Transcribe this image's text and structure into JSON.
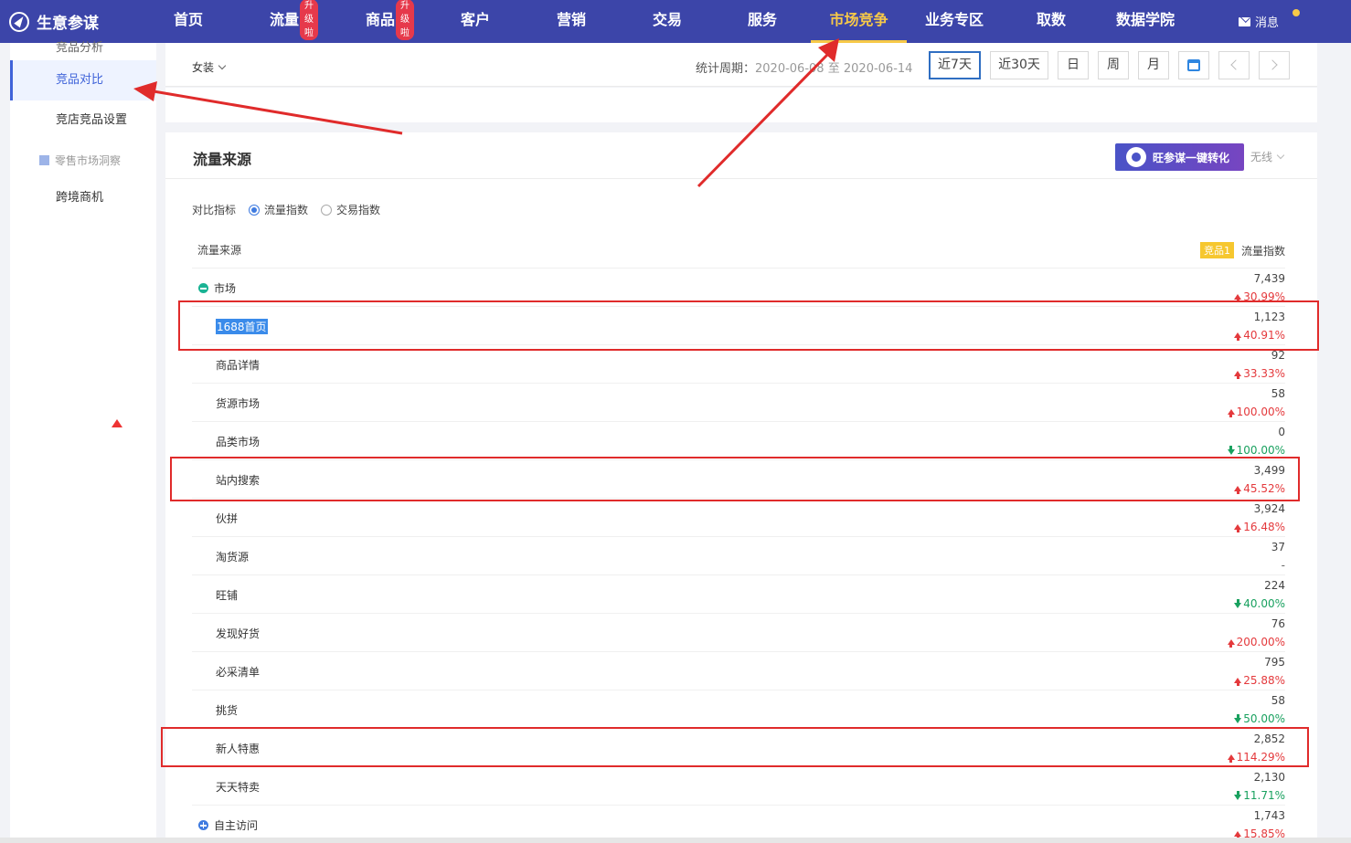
{
  "brand": {
    "name": "生意参谋"
  },
  "nav": {
    "items": [
      {
        "label": "首页"
      },
      {
        "label": "流量",
        "badge": "升级啦"
      },
      {
        "label": "商品",
        "badge": "升级啦"
      },
      {
        "label": "客户"
      },
      {
        "label": "营销"
      },
      {
        "label": "交易"
      },
      {
        "label": "服务"
      },
      {
        "label": "市场竞争",
        "active": true
      },
      {
        "label": "业务专区"
      },
      {
        "label": "取数"
      },
      {
        "label": "数据学院"
      }
    ],
    "message_label": "消息"
  },
  "sidebar": {
    "cut_item": "竞品分析",
    "items": [
      {
        "label": "竞品对比",
        "active": true
      },
      {
        "label": "竞店竞品设置"
      }
    ],
    "group_label": "零售市场洞察",
    "group_items": [
      {
        "label": "跨境商机"
      }
    ]
  },
  "filter": {
    "category": "女装",
    "period_label": "统计周期：",
    "period_start": "2020-06-08",
    "period_sep": "至",
    "period_end": "2020-06-14",
    "buttons": [
      "近7天",
      "近30天",
      "日",
      "周",
      "月"
    ]
  },
  "panel": {
    "title": "流量来源",
    "convert_button": "旺参谋一键转化",
    "device": "无线",
    "compare_label": "对比指标",
    "options": [
      "流量指数",
      "交易指数"
    ],
    "selected_option": "流量指数",
    "col_source": "流量来源",
    "item_tag": "竞品1",
    "col_metric": "流量指数"
  },
  "rows": [
    {
      "label": "市场",
      "value": "7,439",
      "change": "30.99%",
      "dir": "up",
      "group": "collapse",
      "highlight": false
    },
    {
      "label": "1688首页",
      "value": "1,123",
      "change": "40.91%",
      "dir": "up",
      "selected_text": true
    },
    {
      "label": "商品详情",
      "value": "92",
      "change": "33.33%",
      "dir": "up"
    },
    {
      "label": "货源市场",
      "value": "58",
      "change": "100.00%",
      "dir": "up"
    },
    {
      "label": "品类市场",
      "value": "0",
      "change": "100.00%",
      "dir": "down"
    },
    {
      "label": "站内搜索",
      "value": "3,499",
      "change": "45.52%",
      "dir": "up"
    },
    {
      "label": "伙拼",
      "value": "3,924",
      "change": "16.48%",
      "dir": "up"
    },
    {
      "label": "淘货源",
      "value": "37",
      "change": "-",
      "dir": "none"
    },
    {
      "label": "旺铺",
      "value": "224",
      "change": "40.00%",
      "dir": "down"
    },
    {
      "label": "发现好货",
      "value": "76",
      "change": "200.00%",
      "dir": "up"
    },
    {
      "label": "必采清单",
      "value": "795",
      "change": "25.88%",
      "dir": "up"
    },
    {
      "label": "挑货",
      "value": "58",
      "change": "50.00%",
      "dir": "down"
    },
    {
      "label": "新人特惠",
      "value": "2,852",
      "change": "114.29%",
      "dir": "up"
    },
    {
      "label": "天天特卖",
      "value": "2,130",
      "change": "11.71%",
      "dir": "down"
    },
    {
      "label": "自主访问",
      "value": "1,743",
      "change": "15.85%",
      "dir": "up",
      "group": "expand"
    }
  ]
}
